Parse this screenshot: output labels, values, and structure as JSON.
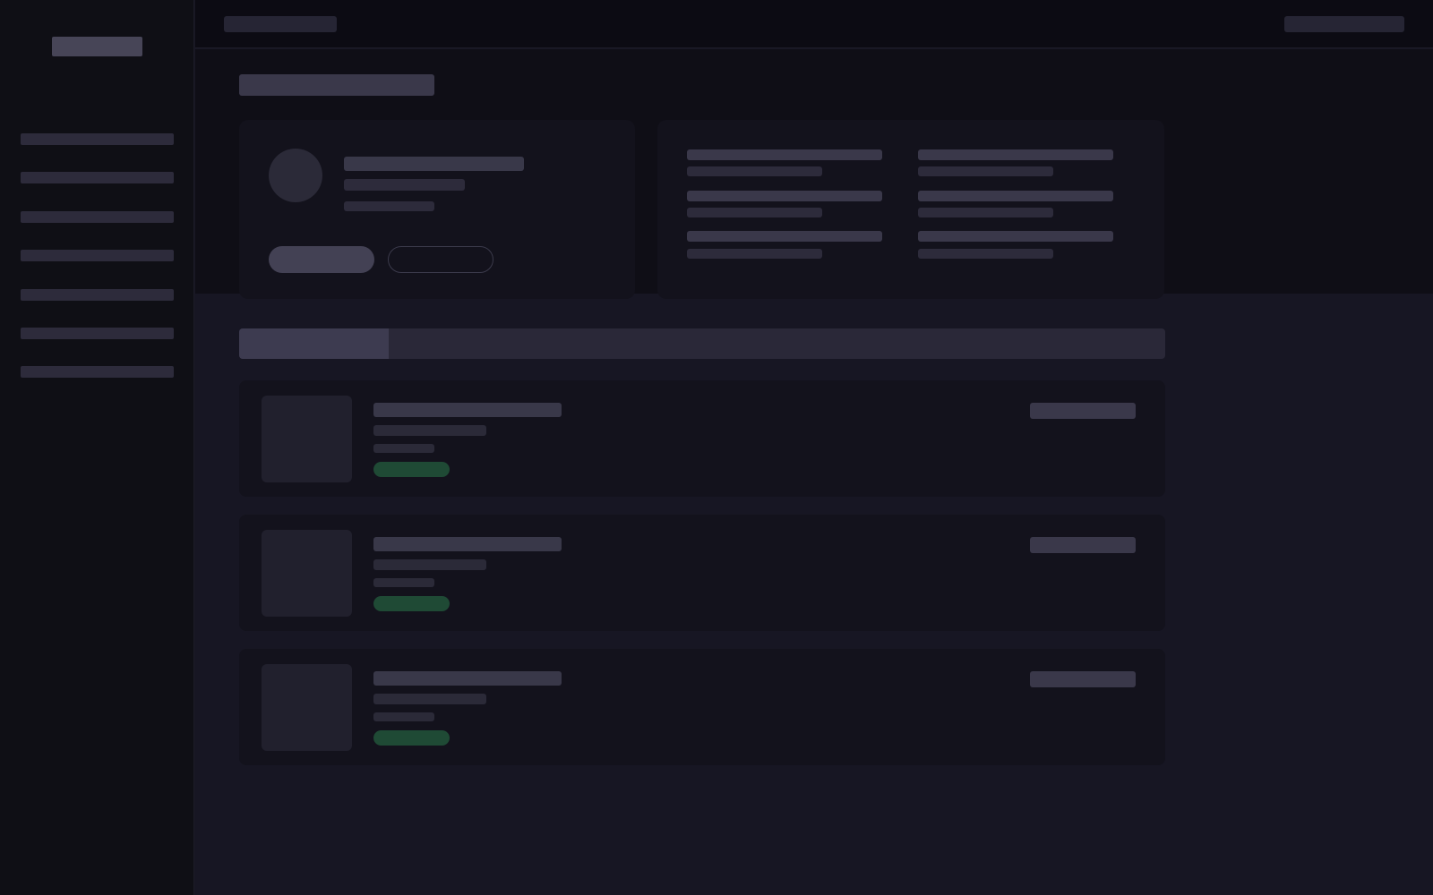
{
  "colors": {
    "background": "#171623",
    "sidebar": "#0f0f15",
    "topbar": "#0c0b13",
    "card": "#13121c",
    "placeholder": "#3a384a",
    "badge_green": "#1f4a35"
  },
  "header": {
    "breadcrumb": "",
    "account": ""
  },
  "sidebar": {
    "logo": "",
    "items": [
      {
        "label": ""
      },
      {
        "label": ""
      },
      {
        "label": ""
      },
      {
        "label": ""
      },
      {
        "label": ""
      },
      {
        "label": ""
      },
      {
        "label": ""
      }
    ]
  },
  "main": {
    "page_title": "",
    "profile": {
      "name": "",
      "subtitle": "",
      "meta": "",
      "primary_button": "",
      "secondary_button": ""
    },
    "stats": [
      {
        "label": "",
        "value": ""
      },
      {
        "label": "",
        "value": ""
      },
      {
        "label": "",
        "value": ""
      },
      {
        "label": "",
        "value": ""
      },
      {
        "label": "",
        "value": ""
      },
      {
        "label": "",
        "value": ""
      }
    ],
    "tabs": [
      {
        "label": "",
        "active": true
      }
    ],
    "rows": [
      {
        "title": "",
        "subtitle": "",
        "meta": "",
        "status": "",
        "price": ""
      },
      {
        "title": "",
        "subtitle": "",
        "meta": "",
        "status": "",
        "price": ""
      },
      {
        "title": "",
        "subtitle": "",
        "meta": "",
        "status": "",
        "price": ""
      }
    ]
  }
}
